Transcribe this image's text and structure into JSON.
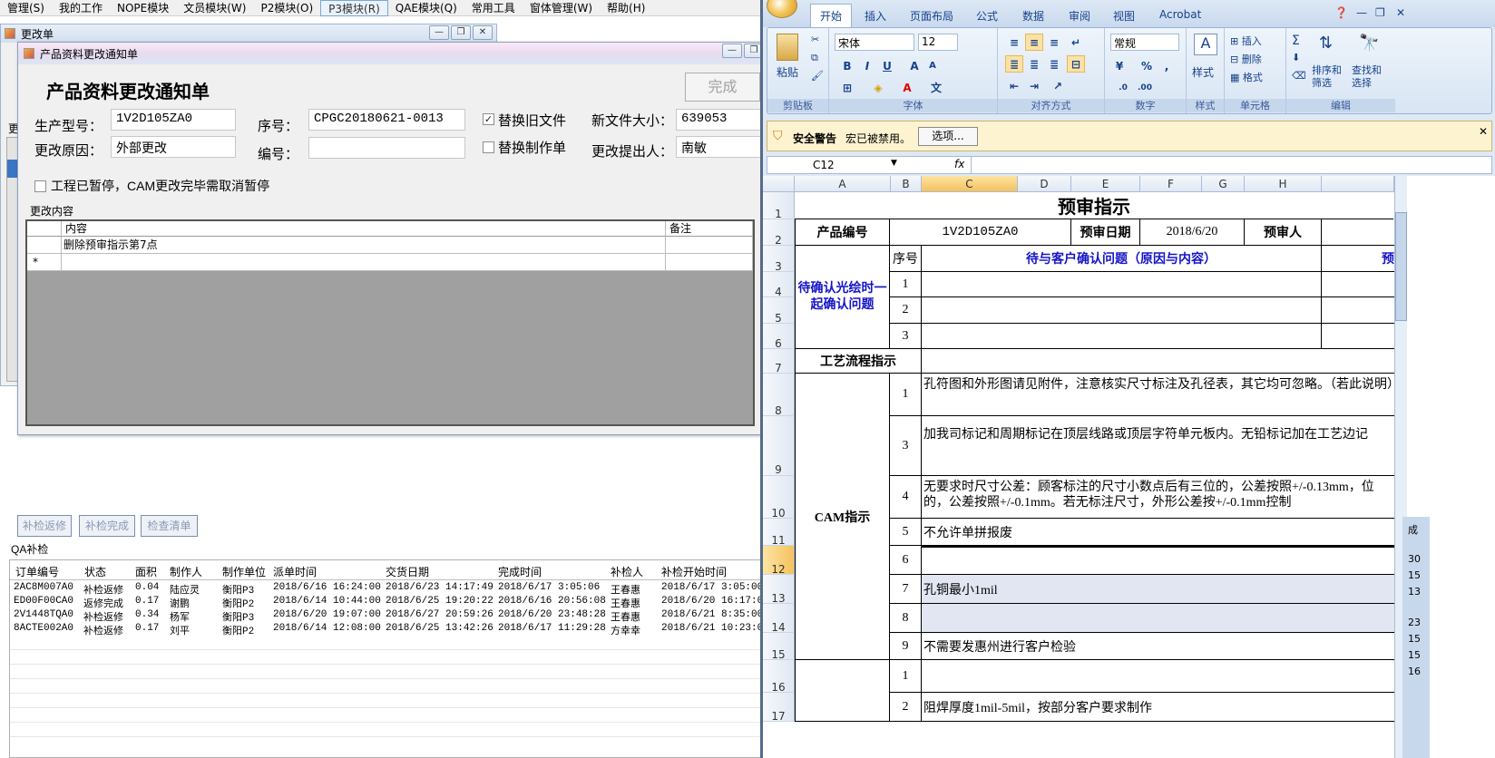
{
  "menubar": [
    "管理(S)",
    "我的工作",
    "NOPE模块",
    "文员模块(W)",
    "P2模块(O)",
    "P3模块(R)",
    "QAE模块(Q)",
    "常用工具",
    "窗体管理(W)",
    "帮助(H)"
  ],
  "bg_window": {
    "title": "更改单",
    "side_label": "更"
  },
  "dialog": {
    "window_title": "产品资料更改通知单",
    "heading": "产品资料更改通知单",
    "done_label": "完成",
    "fields": {
      "model_label": "生产型号：",
      "model_value": "1V2D105ZA0",
      "seq_label": "序号：",
      "seq_value": "CPGC20180621-0013",
      "replace_old_label": "替换旧文件",
      "size_label": "新文件大小：",
      "size_value": "639053",
      "reason_label": "更改原因：",
      "reason_value": "外部更改",
      "code_label": "编号：",
      "code_value": "",
      "replace_make_label": "替换制作单",
      "proposer_label": "更改提出人：",
      "proposer_value": "南敏",
      "pause_label": "工程已暂停，CAM更改完毕需取消暂停",
      "content_section": "更改内容"
    },
    "grid": {
      "headers": [
        "内容",
        "备注"
      ],
      "rows": [
        [
          "删除预审指示第7点",
          ""
        ]
      ],
      "new_row_marker": "*"
    }
  },
  "bottom_buttons": [
    "补检返修",
    "补检完成",
    "检查清单"
  ],
  "qa": {
    "section": "QA补检",
    "headers": [
      "订单编号",
      "状态",
      "面积",
      "制作人",
      "制作单位",
      "派单时间",
      "交货日期",
      "完成时间",
      "补检人",
      "补检开始时间"
    ],
    "rows": [
      [
        "2AC8M007A0",
        "补检返修",
        "0.04",
        "陆应灵",
        "衡阳P3",
        "2018/6/16 16:24:00",
        "2018/6/23 14:17:49",
        "2018/6/17 3:05:06",
        "王春惠",
        "2018/6/17 3:05:00"
      ],
      [
        "ED00F00CA0",
        "返修完成",
        "0.17",
        "谢鹏",
        "衡阳P2",
        "2018/6/14 10:44:00",
        "2018/6/25 19:20:22",
        "2018/6/16 20:56:08",
        "王春惠",
        "2018/6/20 16:17:00"
      ],
      [
        "2V1448TQA0",
        "补检返修",
        "0.34",
        "杨军",
        "衡阳P3",
        "2018/6/20 19:07:00",
        "2018/6/27 20:59:26",
        "2018/6/20 23:48:28",
        "王春惠",
        "2018/6/21 8:35:00"
      ],
      [
        "8ACTE002A0",
        "补检返修",
        "0.17",
        "刘平",
        "衡阳P2",
        "2018/6/14 12:08:00",
        "2018/6/25 13:42:26",
        "2018/6/17 11:29:28",
        "方幸幸",
        "2018/6/21 10:23:00"
      ]
    ]
  },
  "excel": {
    "tabs": [
      "开始",
      "插入",
      "页面布局",
      "公式",
      "数据",
      "审阅",
      "视图",
      "Acrobat"
    ],
    "font_name": "宋体",
    "font_size": "12",
    "number_format": "常规",
    "groups": [
      "剪贴板",
      "字体",
      "对齐方式",
      "数字",
      "样式",
      "单元格",
      "编辑"
    ],
    "clipboard_label": "粘贴",
    "style_label": "样式",
    "cells_buttons": [
      "插入",
      "删除",
      "格式"
    ],
    "edit_buttons": [
      "排序和\n筛选",
      "查找和\n选择"
    ],
    "security": {
      "title": "安全警告",
      "message": "宏已被禁用。",
      "options": "选项..."
    },
    "name_box": "C12",
    "fx": "fx",
    "columns": [
      "A",
      "B",
      "C",
      "D",
      "E",
      "F",
      "G",
      "H"
    ],
    "rows": [
      "1",
      "2",
      "3",
      "4",
      "5",
      "6",
      "7",
      "8",
      "9",
      "10",
      "11",
      "12",
      "13",
      "14",
      "15",
      "16",
      "17"
    ],
    "sheet": {
      "title": "预审指示",
      "product_no_label": "产品编号",
      "product_no": "1V2D105ZA0",
      "date_label": "预审日期",
      "date": "2018/6/20",
      "reviewer_label": "预审人",
      "seq_header": "序号",
      "question_header": "待与客户确认问题（原因与内容）",
      "question_header_right": "预",
      "confirm_label": "待确认光绘时一起确认问题",
      "confirm_nums": [
        "1",
        "2",
        "3"
      ],
      "process_label": "工艺流程指示",
      "cam_label": "CAM指示",
      "cam_rows": [
        {
          "n": "1",
          "text": "孔符图和外形图请见附件，注意核实尺寸标注及孔径表，其它均可忽略。（若此说明）"
        },
        {
          "n": "3",
          "text": "加我司标记和周期标记在顶层线路或顶层字符单元板内。无铅标记加在工艺边记"
        },
        {
          "n": "4",
          "text": "无要求时尺寸公差：顾客标注的尺寸小数点后有三位的，公差按照+/-0.13mm，位的，公差按照+/-0.1mm。若无标注尺寸，外形公差按+/-0.1mm控制"
        },
        {
          "n": "5",
          "text": "不允许单拼报废"
        },
        {
          "n": "6",
          "text": ""
        },
        {
          "n": "7",
          "text": "孔铜最小1mil"
        },
        {
          "n": "8",
          "text": ""
        },
        {
          "n": "9",
          "text": "不需要发惠州进行客户检验"
        }
      ],
      "extra_rows": [
        {
          "n": "1",
          "text": ""
        },
        {
          "n": "2",
          "text": "阻焊厚度1mil-5mil，按部分客户要求制作"
        }
      ]
    }
  },
  "right_strip": [
    "成",
    "30",
    "15",
    "13",
    "23",
    "15",
    "15",
    "16"
  ]
}
